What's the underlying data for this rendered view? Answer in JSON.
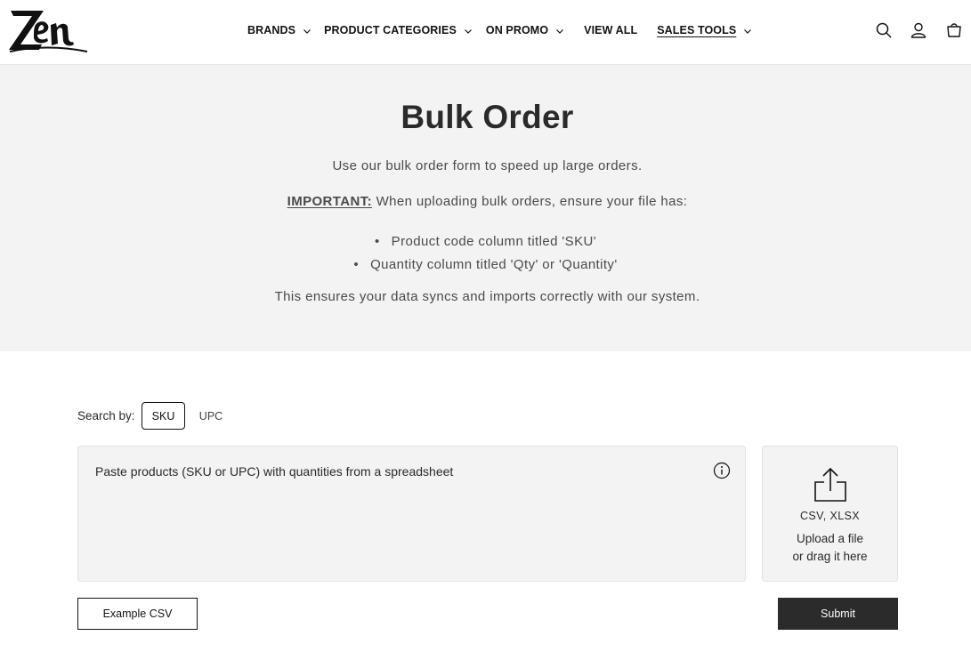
{
  "brand": {
    "logo_text": "ZEN"
  },
  "nav": {
    "items": [
      {
        "label": "BRANDS",
        "has_dropdown": true
      },
      {
        "label": "PRODUCT CATEGORIES",
        "has_dropdown": true
      },
      {
        "label": "ON PROMO",
        "has_dropdown": true
      },
      {
        "label": "VIEW ALL",
        "has_dropdown": false
      },
      {
        "label": "SALES TOOLS",
        "has_dropdown": true,
        "active": true
      }
    ]
  },
  "header_icons": [
    "search-icon",
    "account-icon",
    "cart-icon"
  ],
  "hero": {
    "title": "Bulk Order",
    "intro": "Use our bulk order form to speed up large orders.",
    "important_label": "IMPORTANT:",
    "important_text": " When uploading bulk orders, ensure your file has:",
    "requirements": [
      "Product code column titled 'SKU'",
      "Quantity column titled 'Qty' or 'Quantity'"
    ],
    "ensure": "This ensures your data syncs and imports correctly with our system."
  },
  "search_by": {
    "label": "Search by:",
    "options": [
      "SKU",
      "UPC"
    ],
    "selected": "SKU"
  },
  "paste": {
    "placeholder": "Paste products (SKU or UPC) with quantities from a spreadsheet"
  },
  "upload": {
    "file_types": "CSV, XLSX",
    "line1": "Upload a file",
    "line2": "or drag it here"
  },
  "buttons": {
    "example": "Example CSV",
    "submit": "Submit"
  },
  "colors": {
    "hero_bg": "#f3f3f3",
    "text": "#121212",
    "submit_bg": "#2b2b2b"
  }
}
